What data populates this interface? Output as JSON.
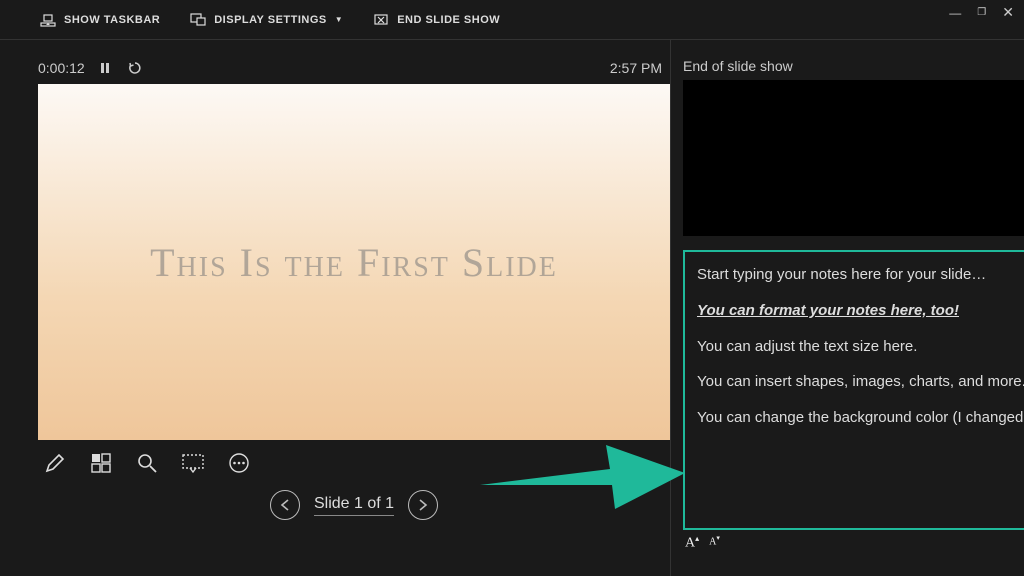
{
  "topbar": {
    "show_taskbar": "SHOW TASKBAR",
    "display_settings": "DISPLAY SETTINGS",
    "end_show": "END SLIDE SHOW"
  },
  "timer": {
    "elapsed": "0:00:12",
    "clock": "2:57 PM"
  },
  "slide": {
    "title": "This Is the First Slide"
  },
  "nav": {
    "label": "Slide 1 of 1"
  },
  "right": {
    "end_label": "End of slide show"
  },
  "notes": {
    "p1": "Start typing your notes here for your slide…",
    "p2": "You can format your notes here, too!",
    "p3": "You can adjust the text size here.",
    "p4": "You can insert shapes, images, charts, and more.",
    "p5": "You can change the background color (I changed it to blue)."
  },
  "colors": {
    "accent": "#1fb99a"
  }
}
